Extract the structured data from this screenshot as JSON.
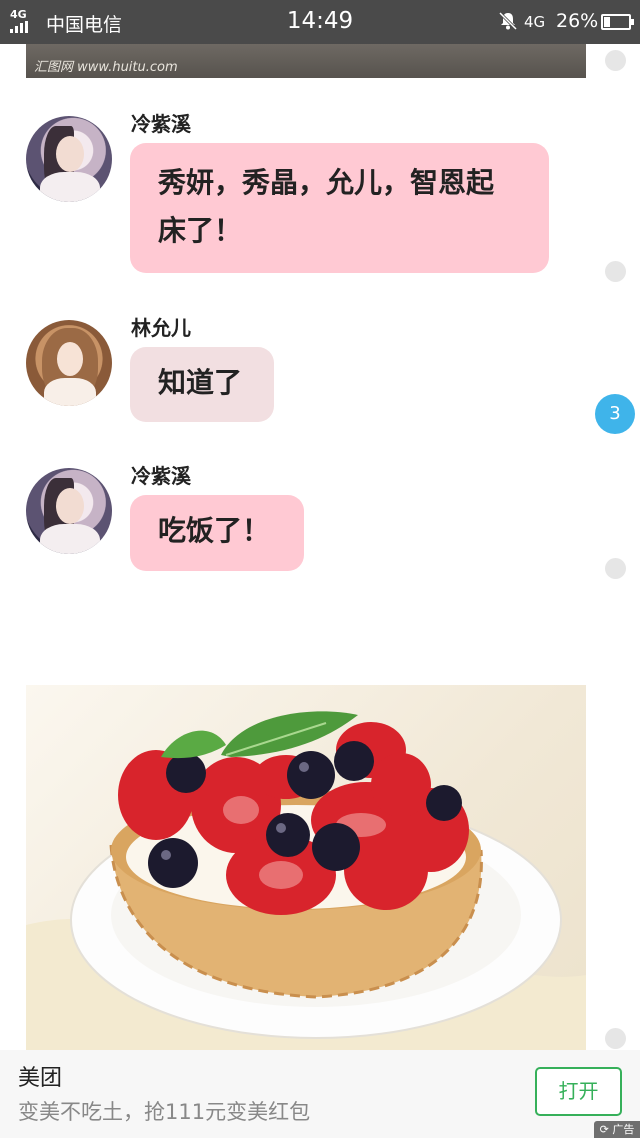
{
  "status_bar": {
    "signal_label": "4G",
    "carrier": "中国电信",
    "time": "14:49",
    "network": "4G",
    "battery_percent": "26%",
    "battery_level": 0.26
  },
  "top_image": {
    "watermark": "汇图网 www.huitu.com"
  },
  "messages": [
    {
      "sender": "冷紫溪",
      "text": "秀妍，秀晶，允儿，智恩起床了！",
      "bubble_color": "#ffc9d3"
    },
    {
      "sender": "林允儿",
      "text": "知道了",
      "bubble_color": "#f2dfe1"
    },
    {
      "sender": "冷紫溪",
      "text": "吃饭了！",
      "bubble_color": "#ffc9d3"
    }
  ],
  "unread_badge": "3",
  "ad": {
    "brand": "美团",
    "slogan": "变美不吃土，抢111元变美红包",
    "open_button": "打开",
    "tag": "广告",
    "accent_color": "#36b05a"
  },
  "icons": [
    "mute-bell-icon",
    "battery-icon",
    "signal-icon",
    "refresh-icon"
  ]
}
